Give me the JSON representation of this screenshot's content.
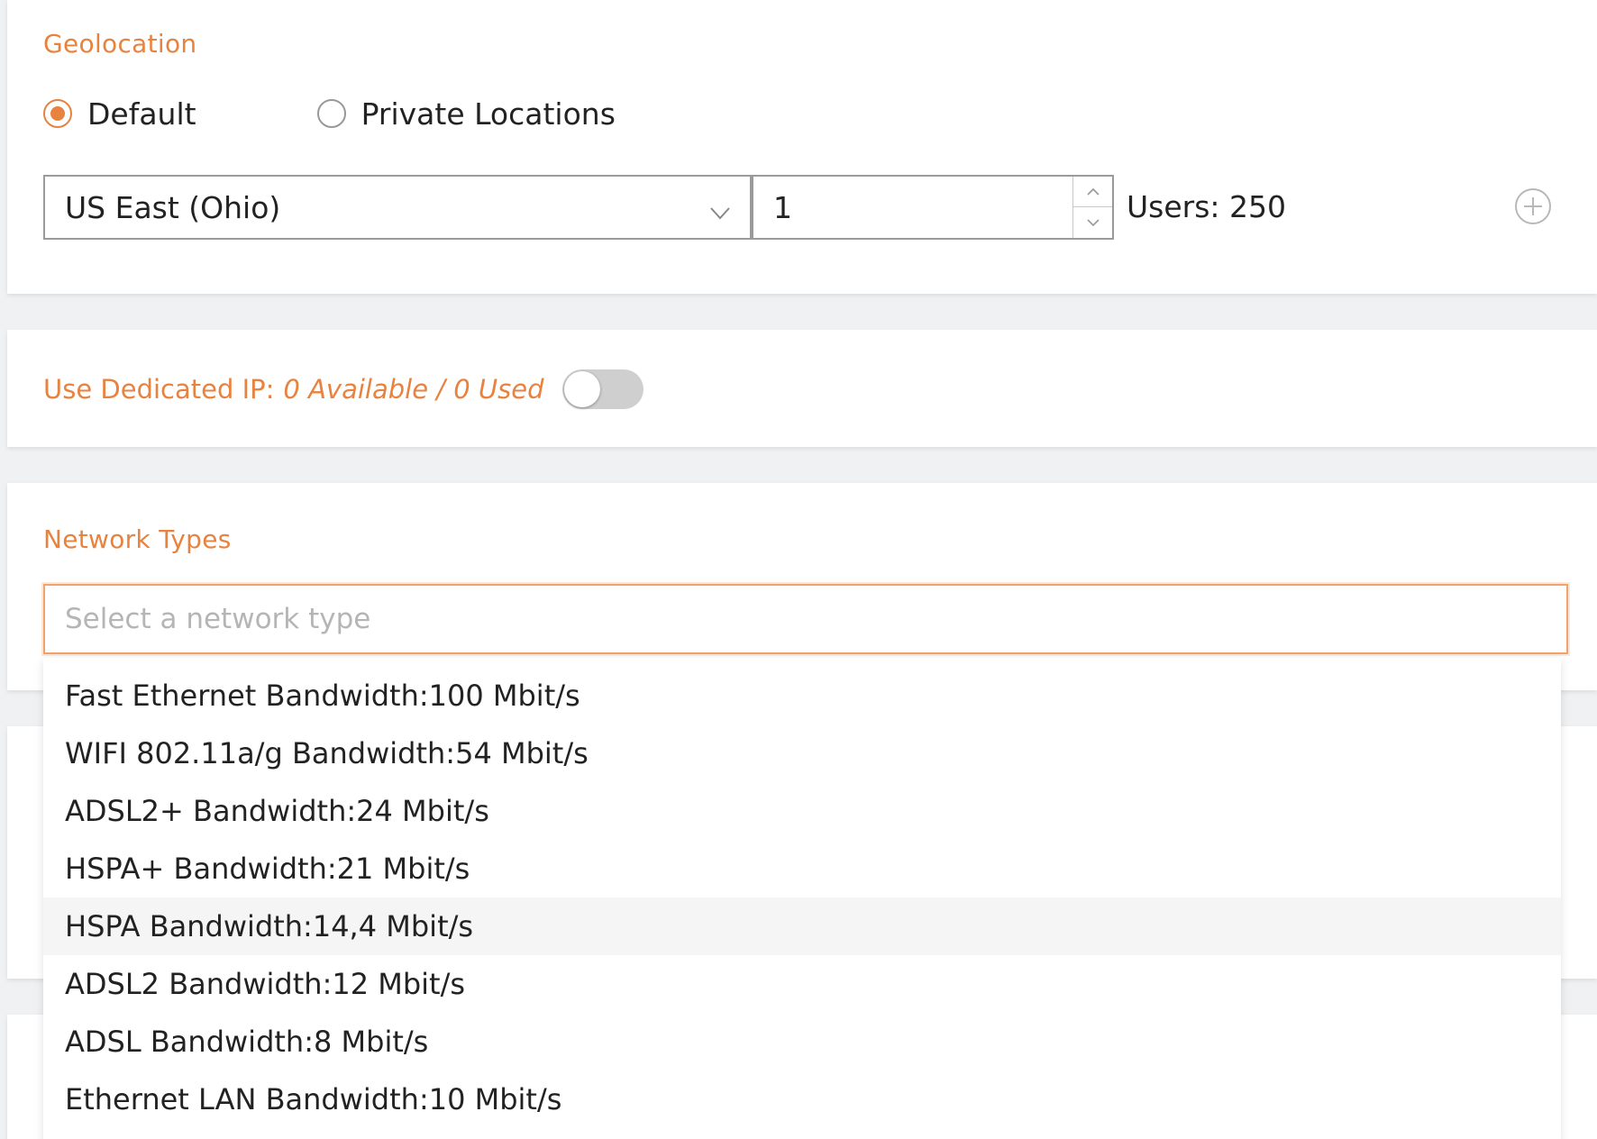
{
  "geolocation": {
    "title": "Geolocation",
    "radios": [
      {
        "label": "Default",
        "checked": true
      },
      {
        "label": "Private Locations",
        "checked": false
      }
    ],
    "location": "US East (Ohio)",
    "count": "1",
    "users": "Users: 250"
  },
  "dedicated_ip": {
    "label": "Use Dedicated IP:",
    "status": "0 Available / 0 Used",
    "enabled": false
  },
  "network_types": {
    "title": "Network Types",
    "placeholder": "Select a network type",
    "options": [
      "Fast Ethernet Bandwidth:100 Mbit/s",
      "WIFI 802.11a/g Bandwidth:54 Mbit/s",
      "ADSL2+ Bandwidth:24 Mbit/s",
      "HSPA+ Bandwidth:21 Mbit/s",
      "HSPA Bandwidth:14,4 Mbit/s",
      "ADSL2 Bandwidth:12 Mbit/s",
      "ADSL Bandwidth:8 Mbit/s",
      "Ethernet LAN Bandwidth:10 Mbit/s"
    ],
    "hover_index": 4
  },
  "colors": {
    "accent": "#e8823f",
    "input_focus": "#f2a26b",
    "toggle_off": "#cfcfcf"
  },
  "icons": {
    "select_chevron": "chevron-down-icon",
    "step_up": "chevron-up-icon",
    "step_down": "chevron-down-icon",
    "add": "plus-circle-icon"
  }
}
